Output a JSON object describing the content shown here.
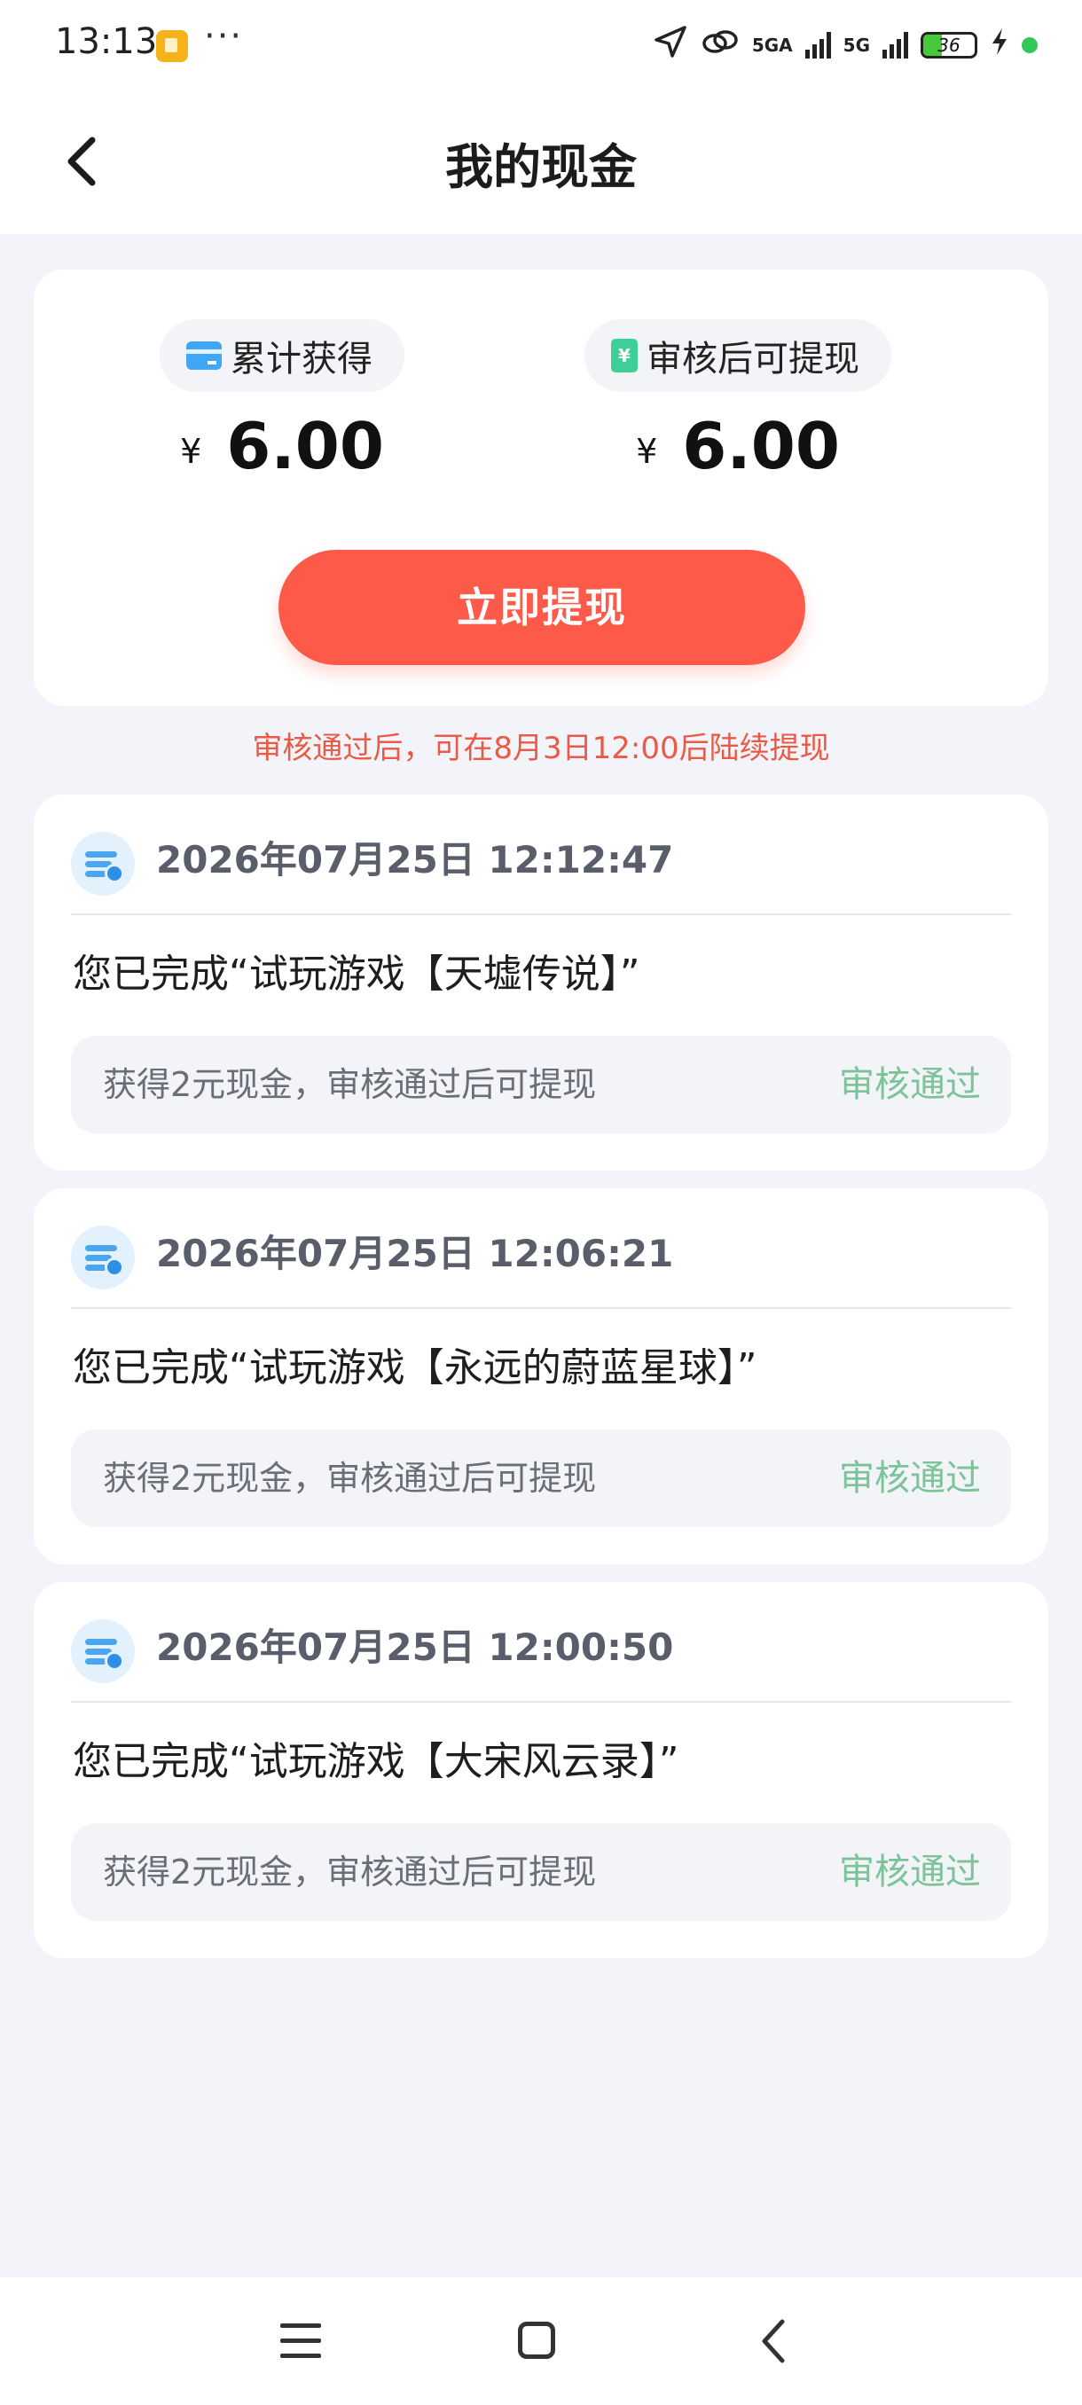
{
  "status_bar": {
    "time": "13:13",
    "more": "···",
    "network_label": "5GA",
    "network_label_2": "5G",
    "battery_level": "36",
    "battery_fraction": 0.36,
    "battery_color": "#46c93a"
  },
  "header": {
    "title": "我的现金"
  },
  "summary": {
    "total_label": "累计获得",
    "total_currency": "¥",
    "total_amount": "6.00",
    "withdrawable_label": "审核后可提现",
    "withdrawable_currency": "¥",
    "withdrawable_amount": "6.00",
    "money_icon_symbol": "¥",
    "withdraw_button_label": "立即提现",
    "accent_color": "#fe5a4a"
  },
  "notice": "审核通过后，可在8月3日12:00后陆续提现",
  "records": [
    {
      "time": "2026年07月25日 12:12:47",
      "title": "您已完成“试玩游戏【天墟传说】”",
      "detail": "获得2元现金，审核通过后可提现",
      "status": "审核通过"
    },
    {
      "time": "2026年07月25日 12:06:21",
      "title": "您已完成“试玩游戏【永远的蔚蓝星球】”",
      "detail": "获得2元现金，审核通过后可提现",
      "status": "审核通过"
    },
    {
      "time": "2026年07月25日 12:00:50",
      "title": "您已完成“试玩游戏【大宋风云录】”",
      "detail": "获得2元现金，审核通过后可提现",
      "status": "审核通过"
    }
  ],
  "icons": {
    "back": "chevron-left-icon",
    "total": "card-icon",
    "withdrawable": "money-icon",
    "record": "list-clock-icon",
    "system_menu": "menu-icon",
    "system_home": "square-icon",
    "system_back": "chevron-left-icon"
  },
  "status_color": "#7cc39a"
}
